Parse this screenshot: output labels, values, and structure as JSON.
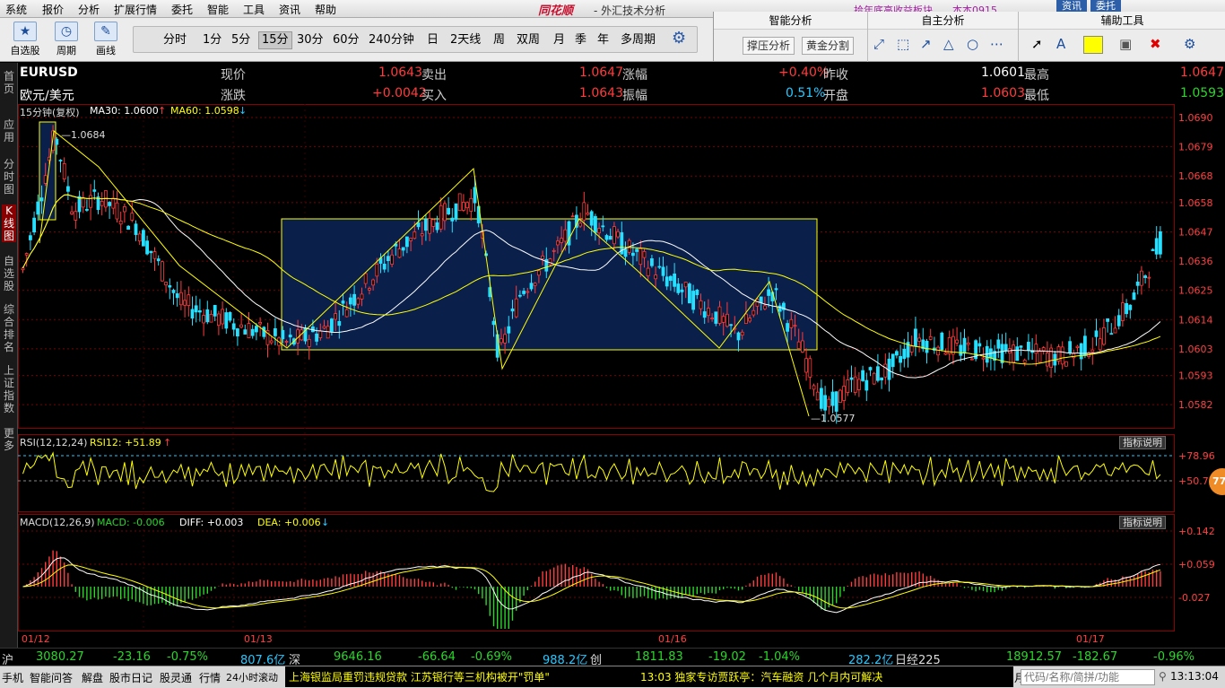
{
  "menu": {
    "items": [
      "系统",
      "报价",
      "分析",
      "扩展行情",
      "委托",
      "智能",
      "工具",
      "资讯",
      "帮助"
    ],
    "brand": "同花顺",
    "title": "- 外汇技术分析",
    "top_ticker": "拾年底高收益板块",
    "top_ticker2": "本本0915",
    "btn_news": "资讯",
    "btn_trade": "委托"
  },
  "toolbar": {
    "self_select": "自选股",
    "period": "周期",
    "draw": "画线",
    "periods": [
      "分时",
      "1分",
      "5分",
      "15分",
      "30分",
      "60分",
      "240分钟",
      "日",
      "2天线",
      "周",
      "双周",
      "月",
      "季",
      "年",
      "多周期"
    ],
    "active_period": "15分"
  },
  "right_panel": {
    "smart_title": "智能分析",
    "self_title": "自主分析",
    "aux_title": "辅助工具",
    "btn_support": "撑压分析",
    "btn_golden": "黄金分割"
  },
  "left_tabs": [
    "首页",
    "应用",
    "分时图",
    "K线图",
    "自选股",
    "综合排名",
    "上证指数",
    "更多"
  ],
  "quote": {
    "symbol": "EURUSD",
    "name": "欧元/美元",
    "cur_label": "现价",
    "cur": "1.0643",
    "sell_label": "卖出",
    "sell": "1.0647",
    "chg_pct_label": "涨幅",
    "chg_pct": "+0.40%",
    "prev_label": "昨收",
    "prev": "1.0601",
    "high_label": "最高",
    "high": "1.0647",
    "chg_label": "涨跌",
    "chg": "+0.0042",
    "buy_label": "买入",
    "buy": "1.0643",
    "amp_label": "振幅",
    "amp": "0.51%",
    "open_label": "开盘",
    "open": "1.0603",
    "low_label": "最低",
    "low": "1.0593"
  },
  "indicators": {
    "main_label": "15分钟(复权)",
    "ma30": "MA30: 1.0600",
    "ma60": "MA60: 1.0598",
    "rsi_label": "RSI(12,12,24)",
    "rsi12": "RSI12: +51.89",
    "macd_label": "MACD(12,26,9)",
    "macd": "MACD: -0.006",
    "diff": "DIFF: +0.003",
    "dea": "DEA: +0.006",
    "help": "指标说明",
    "marker": "77"
  },
  "chart_data": {
    "type": "candlestick",
    "symbol": "EURUSD",
    "ylim": [
      1.0577,
      1.069
    ],
    "y_ticks": [
      "1.0690",
      "1.0679",
      "1.0668",
      "1.0658",
      "1.0647",
      "1.0636",
      "1.0625",
      "1.0614",
      "1.0603",
      "1.0593",
      "1.0582"
    ],
    "x_ticks": [
      "01/12",
      "01/13",
      "01/16",
      "01/17"
    ],
    "annot_high": "1.0684",
    "annot_low": "1.0577",
    "rsi_ticks": [
      "+78.96",
      "+50.77"
    ],
    "macd_ticks": [
      "+0.142",
      "+0.059",
      "-0.027"
    ]
  },
  "status": {
    "sh_label": "沪",
    "sh_val": "3080.27",
    "sh_chg": "-23.16",
    "sh_pct": "-0.75%",
    "sh_amt": "807.6亿",
    "sz_label": "深",
    "sz_val": "9646.16",
    "sz_chg": "-66.64",
    "sz_pct": "-0.69%",
    "sz_amt": "988.2亿",
    "cy_label": "创",
    "cy_val": "1811.83",
    "cy_chg": "-19.02",
    "cy_pct": "-1.04%",
    "cy_amt": "282.2亿",
    "nk_label": "日经225",
    "nk_val": "18912.57",
    "nk_chg": "-182.67",
    "nk_pct": "-0.96%"
  },
  "taskbar": {
    "items": [
      "手机",
      "智能问答",
      "解盘",
      "股市日记",
      "股灵通",
      "行情",
      "24小时滚动"
    ],
    "news1": "上海银监局重罚违规贷款  江苏银行等三机构被开\"罚单\"",
    "news2": "13:03 独家专访贾跃亭：汽车融资 几个月内可解决",
    "news_time": "12:11 1月",
    "search_placeholder": "代码/名称/简拼/功能",
    "clock": "13:13:04"
  }
}
